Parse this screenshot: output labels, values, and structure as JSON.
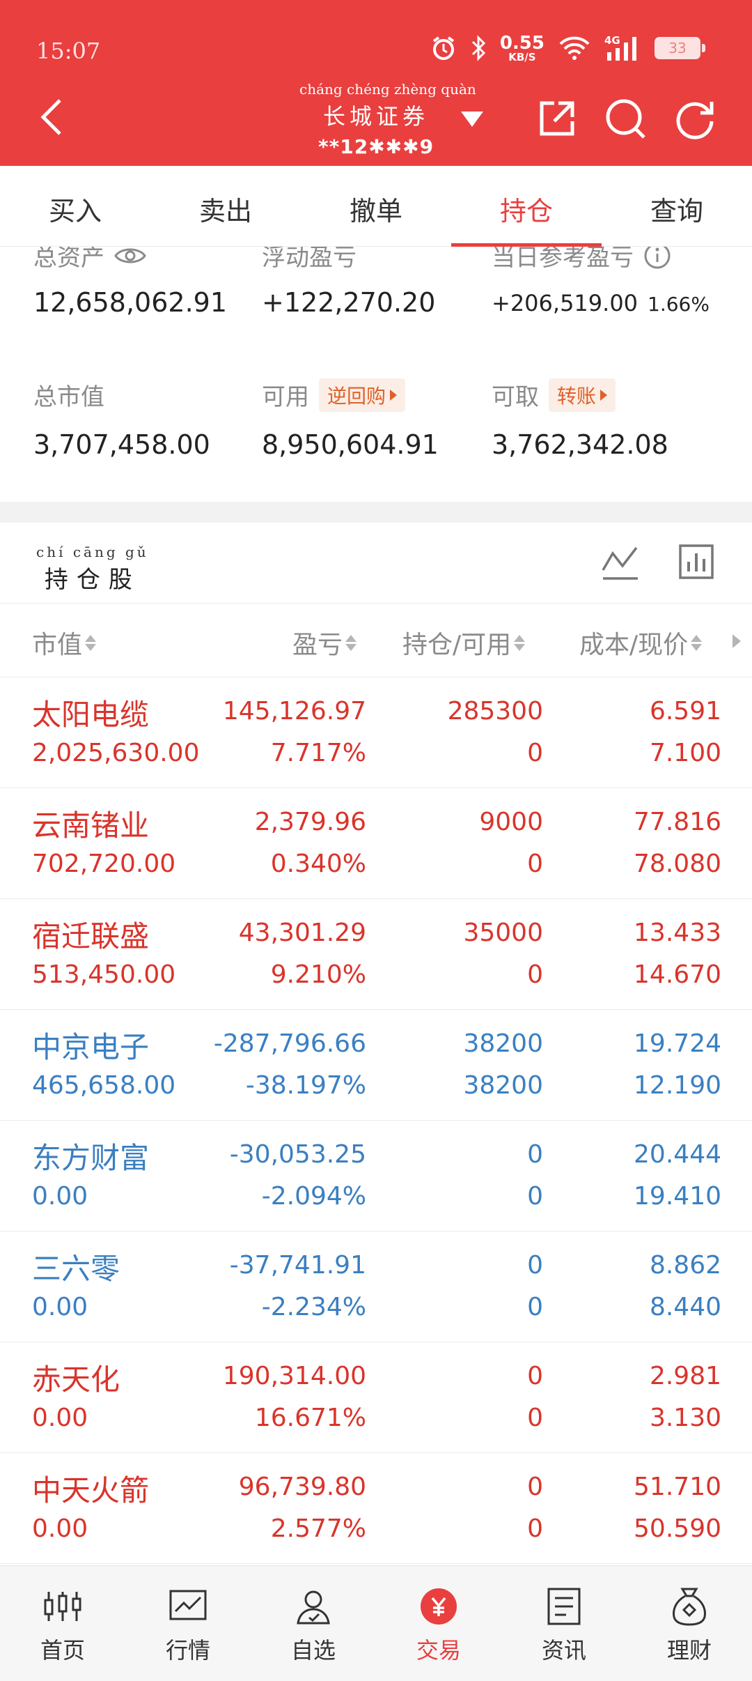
{
  "status_bar": {
    "time": "15:07",
    "net_speed_value": "0.55",
    "net_speed_unit": "KB/S",
    "network": "4G",
    "battery": "33"
  },
  "header": {
    "broker_pinyin": "cháng chéng zhèng quàn",
    "broker_name": "长城证券",
    "account": "**12✱✱✱9"
  },
  "tabs": [
    {
      "label": "买入",
      "active": false
    },
    {
      "label": "卖出",
      "active": false
    },
    {
      "label": "撤单",
      "active": false
    },
    {
      "label": "持仓",
      "active": true
    },
    {
      "label": "查询",
      "active": false
    }
  ],
  "summary": {
    "total_assets_label": "总资产",
    "total_assets": "12,658,062.91",
    "floating_pnl_label": "浮动盈亏",
    "floating_pnl": "+122,270.20",
    "daily_pnl_label": "当日参考盈亏",
    "daily_pnl": "+206,519.00",
    "daily_pnl_pct": "1.66%",
    "market_value_label": "总市值",
    "market_value": "3,707,458.00",
    "available_label": "可用",
    "reverse_repo_tag": "逆回购",
    "available": "8,950,604.91",
    "withdrawable_label": "可取",
    "transfer_tag": "转账",
    "withdrawable": "3,762,342.08"
  },
  "holdings": {
    "title_pinyin": "chí cāng gǔ",
    "title": "持仓股",
    "columns": {
      "market_value": "市值",
      "pnl": "盈亏",
      "position": "持仓/可用",
      "cost_price": "成本/现价"
    },
    "rows": [
      {
        "name": "太阳电缆",
        "market_value": "2,025,630.00",
        "pnl": "145,126.97",
        "pnl_pct": "7.717%",
        "holding": "285300",
        "available": "0",
        "cost": "6.591",
        "price": "7.100",
        "trend": "up"
      },
      {
        "name": "云南锗业",
        "market_value": "702,720.00",
        "pnl": "2,379.96",
        "pnl_pct": "0.340%",
        "holding": "9000",
        "available": "0",
        "cost": "77.816",
        "price": "78.080",
        "trend": "up"
      },
      {
        "name": "宿迁联盛",
        "market_value": "513,450.00",
        "pnl": "43,301.29",
        "pnl_pct": "9.210%",
        "holding": "35000",
        "available": "0",
        "cost": "13.433",
        "price": "14.670",
        "trend": "up"
      },
      {
        "name": "中京电子",
        "market_value": "465,658.00",
        "pnl": "-287,796.66",
        "pnl_pct": "-38.197%",
        "holding": "38200",
        "available": "38200",
        "cost": "19.724",
        "price": "12.190",
        "trend": "down"
      },
      {
        "name": "东方财富",
        "market_value": "0.00",
        "pnl": "-30,053.25",
        "pnl_pct": "-2.094%",
        "holding": "0",
        "available": "0",
        "cost": "20.444",
        "price": "19.410",
        "trend": "down"
      },
      {
        "name": "三六零",
        "market_value": "0.00",
        "pnl": "-37,741.91",
        "pnl_pct": "-2.234%",
        "holding": "0",
        "available": "0",
        "cost": "8.862",
        "price": "8.440",
        "trend": "down"
      },
      {
        "name": "赤天化",
        "market_value": "0.00",
        "pnl": "190,314.00",
        "pnl_pct": "16.671%",
        "holding": "0",
        "available": "0",
        "cost": "2.981",
        "price": "3.130",
        "trend": "up"
      },
      {
        "name": "中天火箭",
        "market_value": "0.00",
        "pnl": "96,739.80",
        "pnl_pct": "2.577%",
        "holding": "0",
        "available": "0",
        "cost": "51.710",
        "price": "50.590",
        "trend": "up"
      }
    ]
  },
  "bottom_nav": [
    {
      "label": "首页",
      "icon": "candlestick-icon",
      "active": false
    },
    {
      "label": "行情",
      "icon": "market-chart-icon",
      "active": false
    },
    {
      "label": "自选",
      "icon": "watchlist-person-icon",
      "active": false
    },
    {
      "label": "交易",
      "icon": "yen-trade-icon",
      "active": true
    },
    {
      "label": "资讯",
      "icon": "news-doc-icon",
      "active": false
    },
    {
      "label": "理财",
      "icon": "money-bag-icon",
      "active": false
    }
  ],
  "colors": {
    "brand_red": "#e93f3f",
    "gain_red": "#d9342b",
    "loss_blue": "#3a7fc1",
    "tag_orange": "#e0602a"
  }
}
